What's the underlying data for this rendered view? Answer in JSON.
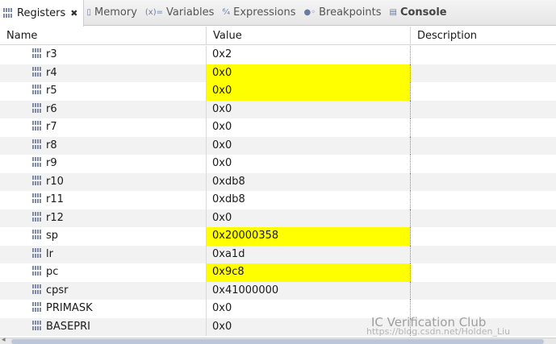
{
  "tabs": [
    {
      "label": "Registers",
      "icon": "registers-icon",
      "active": true,
      "closable": true
    },
    {
      "label": "Memory",
      "icon": "memory-icon"
    },
    {
      "label": "Variables",
      "icon": "variables-icon"
    },
    {
      "label": "Expressions",
      "icon": "expressions-icon"
    },
    {
      "label": "Breakpoints",
      "icon": "breakpoints-icon"
    },
    {
      "label": "Console",
      "icon": "console-icon"
    }
  ],
  "table": {
    "headers": {
      "name": "Name",
      "value": "Value",
      "description": "Description"
    },
    "rows": [
      {
        "name": "r3",
        "value": "0x2",
        "changed": false
      },
      {
        "name": "r4",
        "value": "0x0",
        "changed": true
      },
      {
        "name": "r5",
        "value": "0x0",
        "changed": true
      },
      {
        "name": "r6",
        "value": "0x0",
        "changed": false
      },
      {
        "name": "r7",
        "value": "0x0",
        "changed": false
      },
      {
        "name": "r8",
        "value": "0x0",
        "changed": false
      },
      {
        "name": "r9",
        "value": "0x0",
        "changed": false
      },
      {
        "name": "r10",
        "value": "0xdb8",
        "changed": false
      },
      {
        "name": "r11",
        "value": "0xdb8",
        "changed": false
      },
      {
        "name": "r12",
        "value": "0x0",
        "changed": false
      },
      {
        "name": "sp",
        "value": "0x20000358",
        "changed": true
      },
      {
        "name": "lr",
        "value": "0xa1d",
        "changed": false
      },
      {
        "name": "pc",
        "value": "0x9c8",
        "changed": true
      },
      {
        "name": "cpsr",
        "value": "0x41000000",
        "changed": false
      },
      {
        "name": "PRIMASK",
        "value": "0x0",
        "changed": false
      },
      {
        "name": "BASEPRI",
        "value": "0x0",
        "changed": false
      }
    ]
  },
  "colors": {
    "changed_highlight": "#ffff00",
    "alt_row": "#f2f2f2"
  },
  "watermark": {
    "line1": "IC Verification Club",
    "line2": "https://blog.csdn.net/Holden_Liu"
  }
}
